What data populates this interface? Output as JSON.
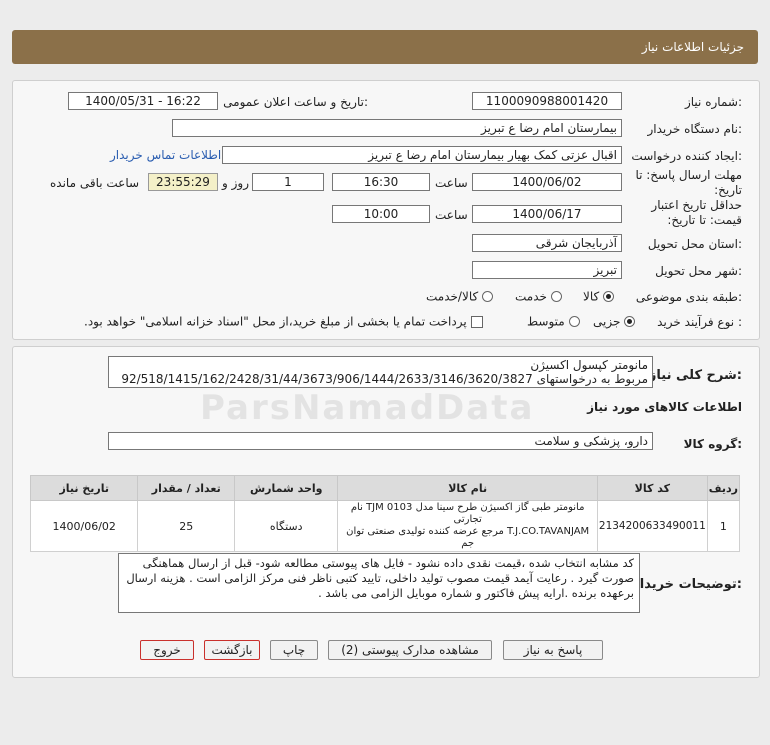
{
  "header": {
    "title": "جزئیات اطلاعات نیاز"
  },
  "form": {
    "need_number_label": "شماره نیاز:",
    "need_number": "1100090988001420",
    "announce_label": "تاریخ و ساعت اعلان عمومی:",
    "announce_value": "1400/05/31 - 16:22",
    "buyer_org_label": "نام دستگاه خریدار:",
    "buyer_org": "بیمارستان امام رضا  ع  تبریز",
    "requester_label": "ایجاد کننده درخواست:",
    "requester": "اقبال عزتی کمک بهیار بیمارستان امام رضا  ع  تبریز",
    "contact_link": "اطلاعات تماس خریدار",
    "reply_deadline_label": "مهلت ارسال پاسخ: تا تاریخ:",
    "reply_date": "1400/06/02",
    "time_label": "ساعت",
    "reply_time": "16:30",
    "days_value": "1",
    "days_label": "روز و",
    "timer_value": "23:55:29",
    "remaining_label": "ساعت باقی مانده",
    "price_validity_label": "حداقل تاریخ اعتبار قیمت: تا تاریخ:",
    "validity_date": "1400/06/17",
    "validity_time": "10:00",
    "province_label": "استان محل تحویل:",
    "province": "آذربایجان شرقی",
    "city_label": "شهر محل تحویل:",
    "city": "تبریز",
    "category_label": "طبقه بندی موضوعی:",
    "category_options": [
      "کالا",
      "خدمت",
      "کالا/خدمت"
    ],
    "process_label": "نوع فرآیند خرید :",
    "process_options": [
      "جزیی",
      "متوسط"
    ],
    "payment_note": "پرداخت تمام یا بخشی از مبلغ خرید،از محل \"اسناد خزانه اسلامی\" خواهد بود."
  },
  "description": {
    "label": "شرح کلی نیاز:",
    "line1": "مانومتر کپسول اکسیژن",
    "line2": "مربوط به درخواستهای 92/518/1415/162/2428/31/44/3673/906/1444/2633/3146/3620/3827"
  },
  "goods_section_title": "اطلاعات کالاهای مورد نیاز",
  "goods_group_label": "گروه کالا:",
  "goods_group": "دارو، پزشکی و سلامت",
  "watermark_text": "ParsNamadData",
  "table": {
    "headers": [
      "ردیف",
      "کد کالا",
      "نام کالا",
      "واحد شمارش",
      "تعداد / مقدار",
      "تاریخ نیاز"
    ],
    "rows": [
      {
        "row": "1",
        "code": "2134200633490011",
        "name_line1": "مانومتر طبی گاز اکسیژن طرح سینا مدل TJM 0103 نام تجارتی",
        "name_line2": "T.J.CO.TAVANJAM مرجع عرضه کننده تولیدی صنعتی توان",
        "name_line3": "جم",
        "unit": "دستگاه",
        "qty": "25",
        "date": "1400/06/02"
      }
    ]
  },
  "buyer_notes_label": "توضیحات خریدار:",
  "buyer_notes": "کد مشابه انتخاب شده ،قیمت نقدی داده نشود - فایل های پیوستی مطالعه شود- قبل از ارسال هماهنگی صورت گیرد . رعایت آیمد قیمت مصوب تولید داخلی، تایید کتبی ناظر فنی مرکز الزامی است . هزینه ارسال برعهده برنده .ارایه پیش فاکتور و شماره موبایل الزامی می باشد .",
  "buttons": {
    "reply": "پاسخ به نیاز",
    "attachments": "مشاهده مدارک پیوستی (2)",
    "print": "چاپ",
    "back": "بازگشت",
    "exit": "خروج"
  }
}
